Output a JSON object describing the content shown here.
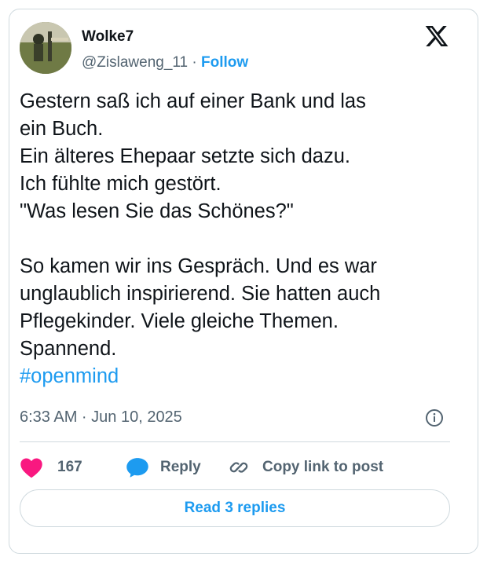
{
  "user": {
    "name": "Wolke7",
    "handle": "@Zislaweng_11",
    "separator": "·",
    "follow_label": "Follow"
  },
  "tweet": {
    "lines": [
      "Gestern saß ich auf einer Bank und las",
      "ein Buch.",
      "Ein älteres Ehepaar setzte sich dazu.",
      "Ich fühlte mich gestört.",
      "\"Was lesen Sie das Schönes?\"",
      "",
      "So kamen wir ins Gespräch. Und es war",
      "unglaublich inspirierend. Sie hatten auch",
      "Pflegekinder. Viele gleiche Themen.",
      "Spannend."
    ],
    "hashtag": "#openmind",
    "timestamp": "6:33 AM · Jun 10, 2025"
  },
  "actions": {
    "like_count": "167",
    "reply_label": "Reply",
    "copy_link_label": "Copy link to post"
  },
  "read_replies_label": "Read 3 replies",
  "icons": {
    "logo": "x-logo-icon",
    "info": "info-icon",
    "like": "heart-icon",
    "reply": "speech-bubble-icon",
    "link": "link-icon"
  },
  "colors": {
    "accent": "#1d9bf0",
    "like": "#f91880",
    "muted": "#536471",
    "border": "#cfd9de"
  }
}
